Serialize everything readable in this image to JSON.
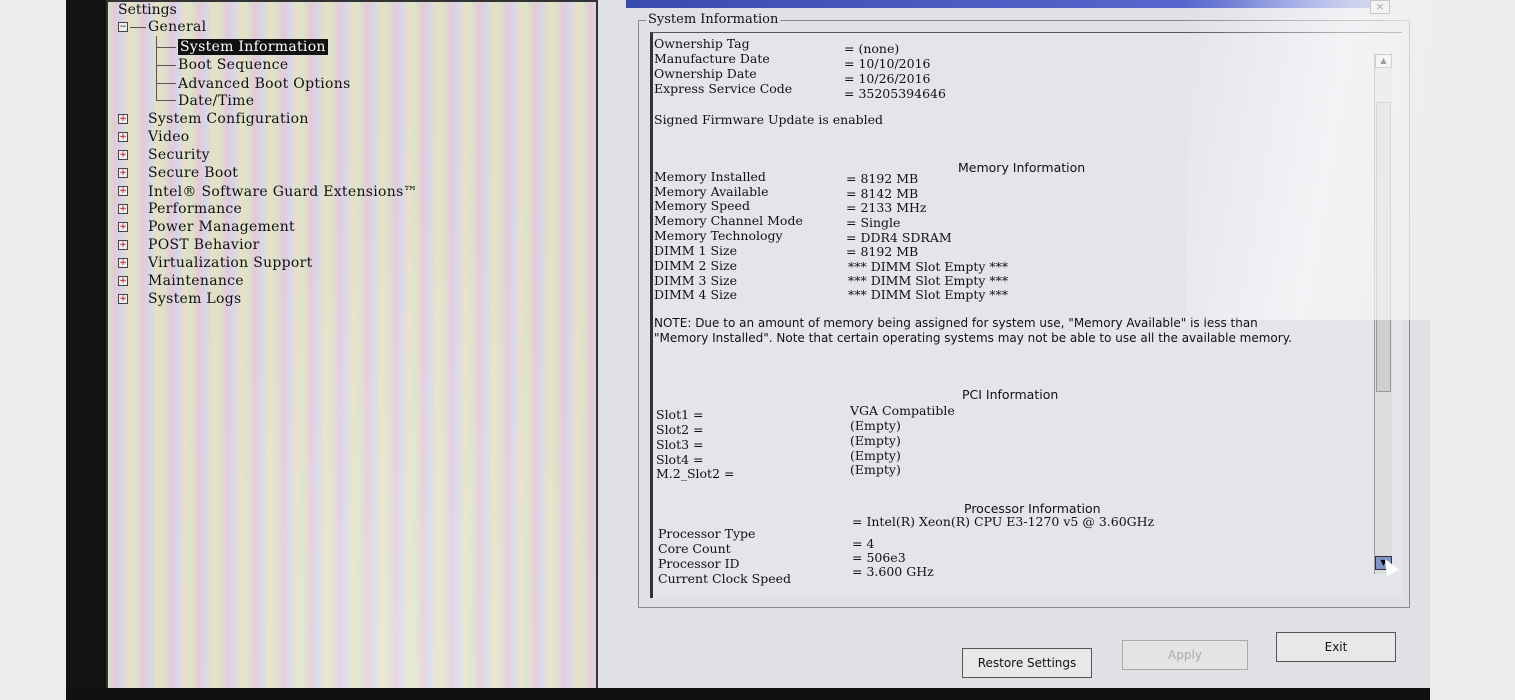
{
  "settings": {
    "title": "Settings",
    "general": {
      "label": "General",
      "children": [
        "System Information",
        "Boot Sequence",
        "Advanced Boot Options",
        "Date/Time"
      ],
      "selected": "System Information"
    },
    "groups": [
      "System Configuration",
      "Video",
      "Security",
      "Secure Boot",
      "Intel® Software Guard Extensions™",
      "Performance",
      "Power Management",
      "POST Behavior",
      "Virtualization Support",
      "Maintenance",
      "System Logs"
    ]
  },
  "panel": {
    "title": "System Information",
    "ownership": [
      {
        "label": "Ownership Tag",
        "value": "= (none)"
      },
      {
        "label": "Manufacture Date",
        "value": "= 10/10/2016"
      },
      {
        "label": "Ownership Date",
        "value": "= 10/26/2016"
      },
      {
        "label": "Express Service Code",
        "value": "= 35205394646"
      }
    ],
    "signed_firmware": "Signed Firmware Update is enabled",
    "memory_heading": "Memory Information",
    "memory": [
      {
        "label": "Memory Installed",
        "value": "= 8192 MB"
      },
      {
        "label": "Memory Available",
        "value": "= 8142 MB"
      },
      {
        "label": "Memory Speed",
        "value": "= 2133 MHz"
      },
      {
        "label": "Memory Channel Mode",
        "value": "= Single"
      },
      {
        "label": "Memory Technology",
        "value": "= DDR4 SDRAM"
      },
      {
        "label": "DIMM 1 Size",
        "value": "= 8192 MB"
      },
      {
        "label": "DIMM 2 Size",
        "value": "*** DIMM Slot Empty ***"
      },
      {
        "label": "DIMM 3 Size",
        "value": "*** DIMM Slot Empty ***"
      },
      {
        "label": "DIMM 4 Size",
        "value": "*** DIMM Slot Empty ***"
      }
    ],
    "note": "NOTE: Due to an amount of memory being assigned for system use, \"Memory Available\" is less than \"Memory Installed\". Note that certain operating systems may not be able to use all the available memory.",
    "pci_heading": "PCI Information",
    "pci": [
      {
        "label": "Slot1 =",
        "value": "VGA Compatible"
      },
      {
        "label": "Slot2 =",
        "value": "(Empty)"
      },
      {
        "label": "Slot3 =",
        "value": "(Empty)"
      },
      {
        "label": "Slot4 =",
        "value": "(Empty)"
      },
      {
        "label": "M.2_Slot2 =",
        "value": "(Empty)"
      }
    ],
    "processor_heading": "Processor Information",
    "processor": [
      {
        "label": "Processor Type",
        "value": "= Intel(R) Xeon(R) CPU E3-1270 v5 @ 3.60GHz"
      },
      {
        "label": "Core Count",
        "value": "= 4"
      },
      {
        "label": "Processor ID",
        "value": "= 506e3"
      },
      {
        "label": "Current Clock Speed",
        "value": "= 3.600 GHz"
      }
    ]
  },
  "buttons": {
    "restore": "Restore Settings",
    "apply": "Apply",
    "exit": "Exit",
    "close": "×"
  }
}
